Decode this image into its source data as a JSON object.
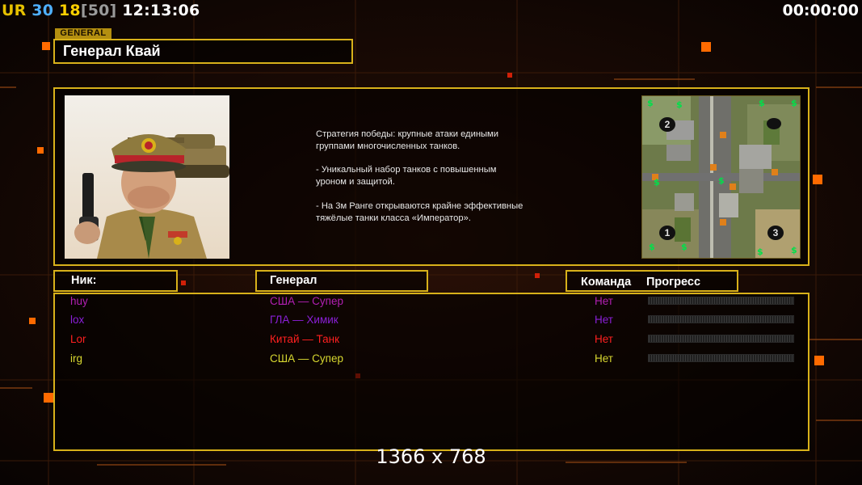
{
  "hud": {
    "ur": "UR",
    "n1": "30",
    "n2": "18",
    "n3": "[50]",
    "clock": "12:13:06",
    "timer": "00:00:00",
    "colors": {
      "ur": "#e5c000",
      "n1": "#4fb0ff",
      "n2": "#ffd000",
      "n3": "#9a9a9a"
    }
  },
  "general_tag": "GENERAL",
  "title": "Генерал Квай",
  "description": [
    "Стратегия победы: крупные атаки едиными\n группами многочисленных танков.",
    "- Уникальный набор танков с повышенным\n уроном и защитой.",
    "- На 3м Ранге открываются крайне эффективные\n тяжёлые танки класса «Император»."
  ],
  "minimap": {
    "slots": [
      "2",
      "1",
      "3"
    ]
  },
  "headers": {
    "nick": "Ник:",
    "general": "Генерал",
    "team": "Команда",
    "progress": "Прогресс"
  },
  "players": [
    {
      "nick": "huy",
      "general": "США — Супер",
      "team": "Нет",
      "color": "#b21fb3",
      "progress": 0
    },
    {
      "nick": "lox",
      "general": "ГЛА — Химик",
      "team": "Нет",
      "color": "#8a1fd8",
      "progress": 0
    },
    {
      "nick": "Lor",
      "general": "Китай — Танк",
      "team": "Нет",
      "color": "#ff2020",
      "progress": 0
    },
    {
      "nick": "irg",
      "general": "США — Супер",
      "team": "Нет",
      "color": "#d8d830",
      "progress": 0
    }
  ],
  "resolution": "1366 x 768"
}
